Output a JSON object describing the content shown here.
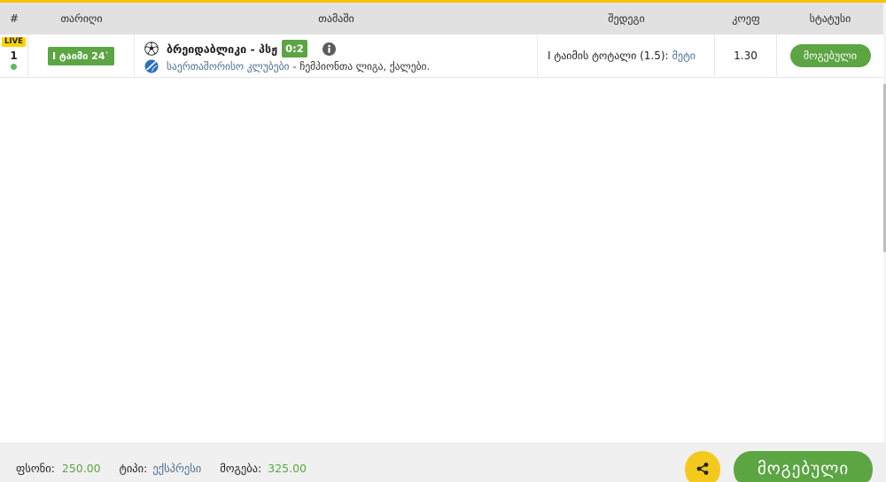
{
  "theme": {
    "accent": "#f5c400",
    "green": "#5ba543",
    "link": "#4a6f93",
    "header_bg": "#e1e1e1",
    "footer_bg": "#f0f0f0",
    "live_badge": "#ffd400",
    "live_dot": "#5cb85c",
    "share_button": "#f4c91d"
  },
  "header": {
    "columns": [
      "#",
      "თარიღი",
      "თამაში",
      "შედეგი",
      "კოეფ",
      "სტატუსი"
    ]
  },
  "bets": [
    {
      "live_badge": "LIVE",
      "number": "1",
      "date": "I ტაიმი 24`",
      "game": {
        "sport_icon": "soccer-ball-icon",
        "teams": "ბრეიდაბლიკი - პსჟ",
        "score": "0:2",
        "info_icon": "info-icon",
        "league_icon": "league-icon",
        "category": "საერთაშორისო კლუბები",
        "league": "- ჩემპიონთა ლიგა, ქალები."
      },
      "result": {
        "market": "I ტაიმის ტოტალი (1.5):",
        "pick": "მეტი"
      },
      "odds": "1.30",
      "status": "მოგებული"
    }
  ],
  "footer": {
    "stake_label": "ფსონი:",
    "stake_value": "250.00",
    "type_label": "ტიპი:",
    "type_value": "ექსპრესი",
    "win_label": "მოგება:",
    "win_value": "325.00",
    "share_icon": "share-icon",
    "status_button": "მოგებული"
  }
}
